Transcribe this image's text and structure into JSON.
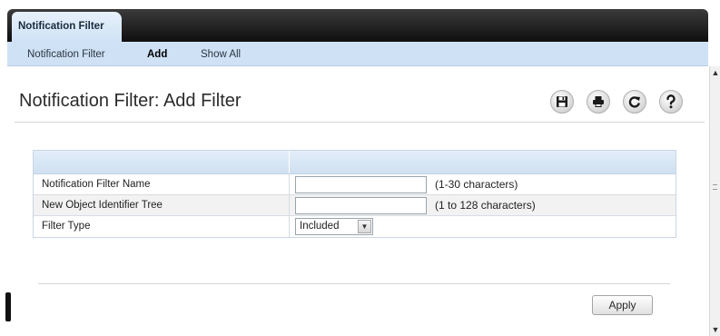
{
  "tabs": {
    "active_label": "Notification Filter"
  },
  "subnav": {
    "items": [
      {
        "label": "Notification Filter",
        "active": false
      },
      {
        "label": "Add",
        "active": true
      },
      {
        "label": "Show All",
        "active": false
      }
    ]
  },
  "page": {
    "title": "Notification Filter: Add Filter"
  },
  "toolbar": {
    "icons": [
      "save-icon",
      "print-icon",
      "refresh-icon",
      "help-icon"
    ]
  },
  "form": {
    "rows": [
      {
        "label": "Notification Filter Name",
        "type": "text",
        "value": "",
        "hint": "(1-30 characters)"
      },
      {
        "label": "New Object Identifier Tree",
        "type": "text",
        "value": "",
        "hint": "(1 to 128 characters)"
      },
      {
        "label": "Filter Type",
        "type": "select",
        "value": "Included"
      }
    ]
  },
  "actions": {
    "apply_label": "Apply"
  },
  "colors": {
    "tab_bar": "#1a1a1a",
    "subnav_bg": "#cfe2f5",
    "header_bg": "#dbe8f5"
  }
}
